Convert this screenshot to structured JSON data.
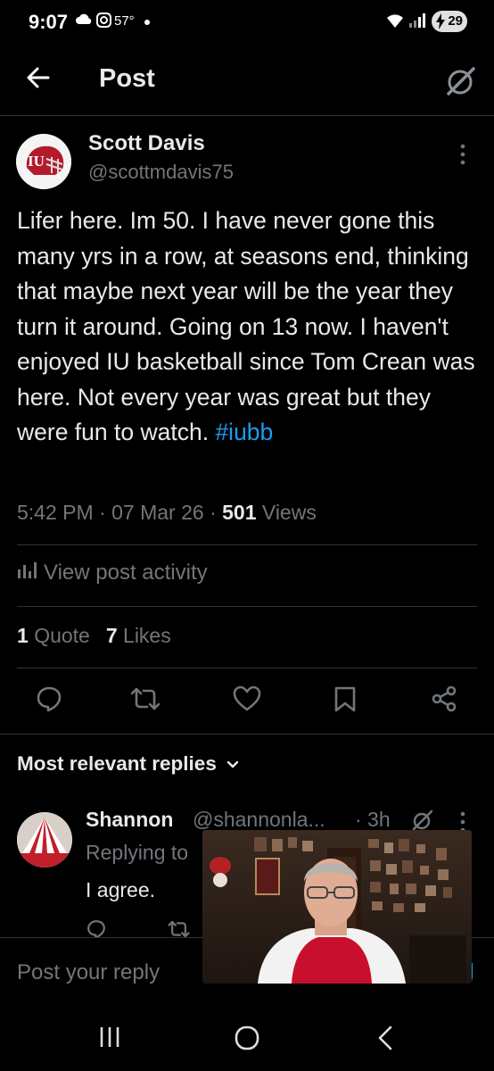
{
  "status_bar": {
    "time": "9:07",
    "temperature": "57°",
    "battery": "29",
    "icons": [
      "cloud-icon",
      "instagram-icon",
      "wifi-icon",
      "signal-icon",
      "battery-charging-icon"
    ]
  },
  "header": {
    "title": "Post",
    "back_icon": "arrow-left-icon",
    "grok_icon": "grok-icon"
  },
  "post": {
    "author_name": "Scott Davis",
    "author_handle": "@scottmdavis75",
    "text": "Lifer here. Im 50. I have never gone this many yrs in a row, at seasons end,  thinking that maybe next year will be the year they turn it around. Going on 13 now. I haven't enjoyed IU basketball since Tom Crean was here. Not every year was great but they were fun to watch.",
    "hashtag": "#iubb",
    "time": "5:42 PM",
    "sep1": "·",
    "date": "07 Mar 26",
    "sep2": "·",
    "views_count": "501",
    "views_label": "Views",
    "activity_label": "View post activity",
    "quotes_count": "1",
    "quotes_label": "Quote",
    "likes_count": "7",
    "likes_label": "Likes"
  },
  "actions": [
    "reply-icon",
    "repost-icon",
    "like-icon",
    "bookmark-icon",
    "share-icon"
  ],
  "replies": {
    "heading": "Most relevant replies",
    "items": [
      {
        "name": "Shannon",
        "handle": "@shannonla...",
        "time": "· 3h",
        "replying_prefix": "Replying to",
        "text": "I agree."
      }
    ]
  },
  "compose": {
    "placeholder": "Post your reply"
  },
  "navbar": [
    "recents-icon",
    "home-icon",
    "back-icon"
  ],
  "colors": {
    "background": "#000000",
    "text": "#e7e9ea",
    "secondary": "#71767b",
    "accent": "#1d9bf0",
    "divider": "#2f3336"
  }
}
